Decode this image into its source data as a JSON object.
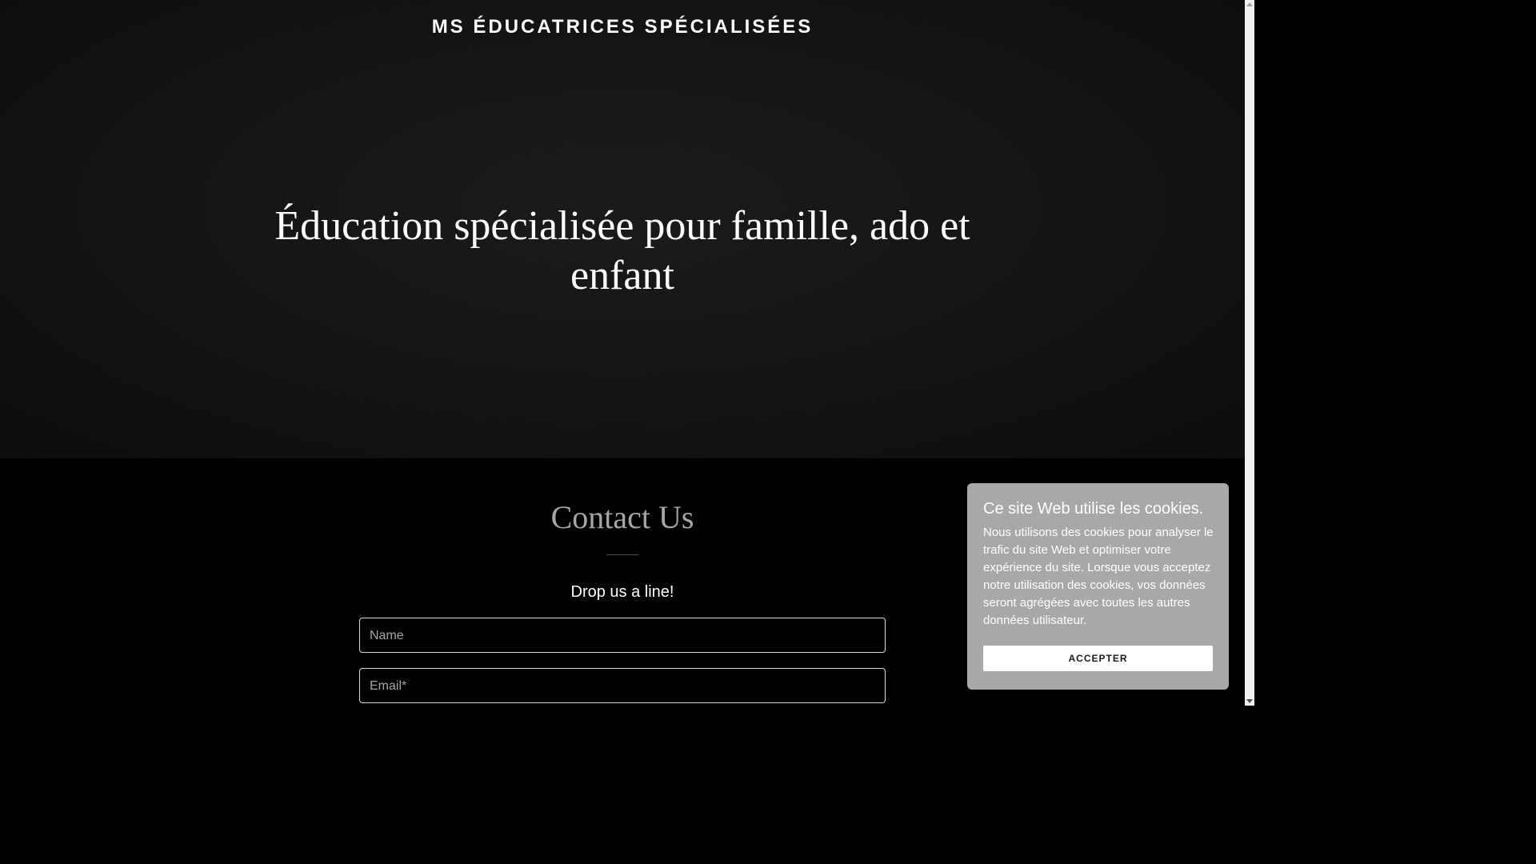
{
  "header": {
    "site_title": "MS ÉDUCATRICES SPÉCIALISÉES"
  },
  "hero": {
    "heading": "Éducation spécialisée pour famille, ado et enfant"
  },
  "contact": {
    "title": "Contact Us",
    "subtitle": "Drop us a line!",
    "fields": {
      "name_placeholder": "Name",
      "email_placeholder": "Email*"
    }
  },
  "cookie_banner": {
    "title": "Ce site Web utilise les cookies.",
    "body": "Nous utilisons des cookies pour analyser le trafic du site Web et optimiser votre expérience du site. Lorsque vous acceptez notre utilisation des cookies, vos données seront agrégées avec toutes les autres données utilisateur.",
    "accept_label": "ACCEPTER"
  },
  "colors": {
    "hero_background": "#141414",
    "page_background": "#000000",
    "cookie_panel": "#a8a8a8",
    "muted_text": "#a6a6a6"
  }
}
